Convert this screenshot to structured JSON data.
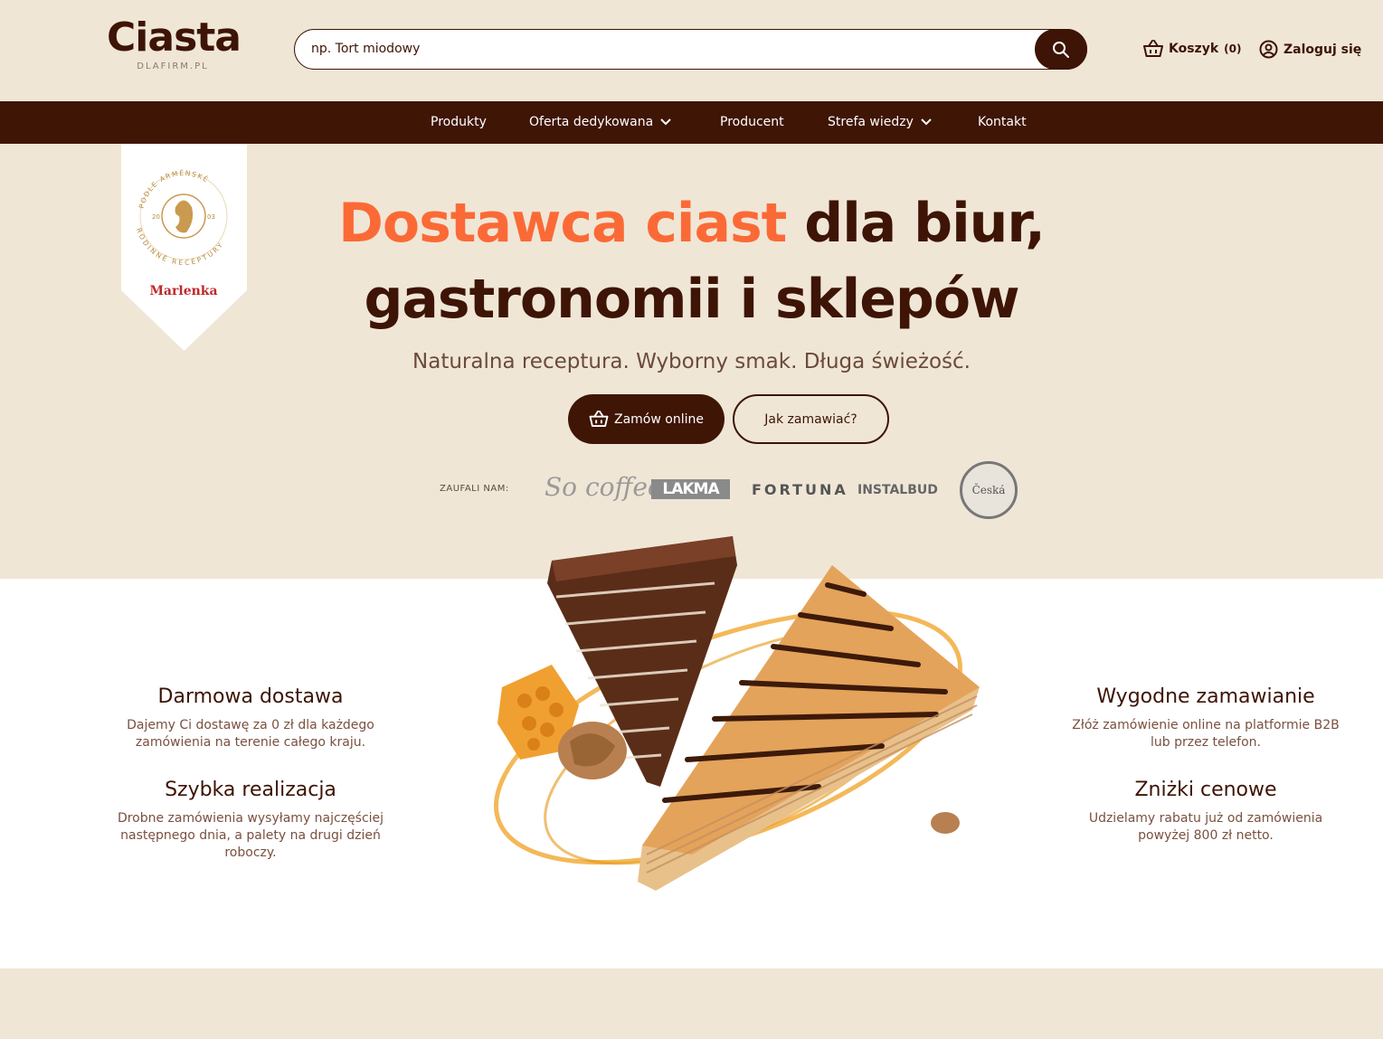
{
  "header": {
    "logo_word": "Ciasta",
    "logo_sub": "DLAFIRM.PL",
    "search_placeholder": "np. Tort miodowy",
    "cart_label": "Koszyk",
    "cart_count": "(0)",
    "login_label": "Zaloguj się"
  },
  "nav": {
    "items": [
      {
        "label": "Produkty"
      },
      {
        "label": "Oferta dedykowana"
      },
      {
        "label": "Producent"
      },
      {
        "label": "Strefa wiedzy"
      },
      {
        "label": "Kontakt"
      }
    ]
  },
  "badge": {
    "ring_text": "PODLE ARMÉNSKÉ RODINNÉ RECEPTURY",
    "year_left": "20",
    "year_right": "03",
    "brand": "Marlenka"
  },
  "hero": {
    "title_accent": "Dostawca ciast",
    "title_rest_1": "dla biur,",
    "title_line_2": "gastronomii i sklepów",
    "subtitle": "Naturalna receptura. Wyborny smak. Długa świeżość.",
    "primary_button": "Zamów online",
    "secondary_button": "Jak zamawiać?"
  },
  "trusted": {
    "label": "ZAUFALI NAM:",
    "brands": [
      "So coffee",
      "LAKMA",
      "FORTUNA",
      "INSTALBUD",
      "Česká"
    ]
  },
  "features": {
    "left": [
      {
        "title": "Darmowa dostawa",
        "text": "Dajemy Ci dostawę za 0 zł dla każdego zamówienia na terenie całego kraju."
      },
      {
        "title": "Szybka realizacja",
        "text": "Drobne zamówienia wysyłamy najczęściej następnego dnia, a palety na drugi dzień roboczy."
      }
    ],
    "right": [
      {
        "title": "Wygodne zamawianie",
        "text": "Złóż zamówienie online na platformie B2B lub przez telefon."
      },
      {
        "title": "Zniżki cenowe",
        "text": "Udzielamy rabatu już od zamówienia powyżej 800 zł netto."
      }
    ]
  },
  "colors": {
    "brand_brown": "#3f1505",
    "accent_orange": "#fb6a36",
    "cream": "#f0e6d6"
  }
}
